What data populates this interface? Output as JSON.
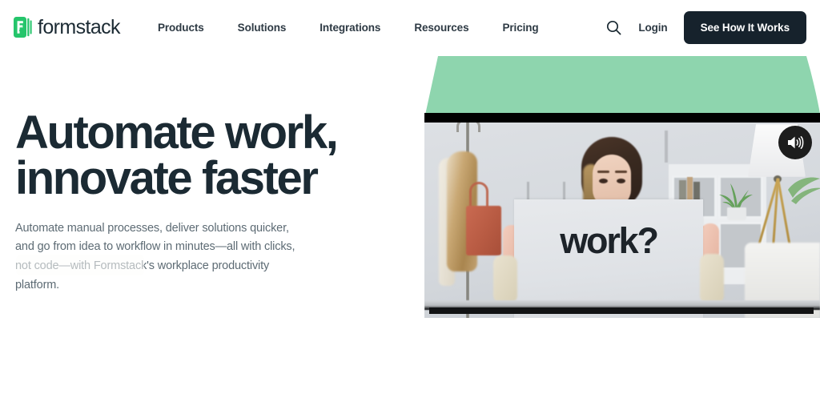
{
  "header": {
    "brand_name": "formstack",
    "logo_icon": "formstack-logo-icon",
    "logo_color": "#25c56b",
    "nav_items": [
      {
        "label": "Products"
      },
      {
        "label": "Solutions"
      },
      {
        "label": "Integrations"
      },
      {
        "label": "Resources"
      },
      {
        "label": "Pricing"
      }
    ],
    "search_icon": "search-icon",
    "login_label": "Login",
    "cta_label": "See How It Works",
    "cta_bg": "#16222c"
  },
  "hero": {
    "headline_line1": "Automate work,",
    "headline_line2": "innovate faster",
    "headline_color": "#1b2a33",
    "subcopy": "Automate manual processes, deliver solutions quicker, and go from idea to workflow in minutes—all with clicks, not code—with Formstack's workplace productivity platform.",
    "subcopy_color": "#5d6b74"
  },
  "media": {
    "accent_shape_color": "#8ed5ae",
    "sign_text": "work?",
    "sound_icon": "speaker-on-icon",
    "sound_button_label": "Unmute video"
  }
}
